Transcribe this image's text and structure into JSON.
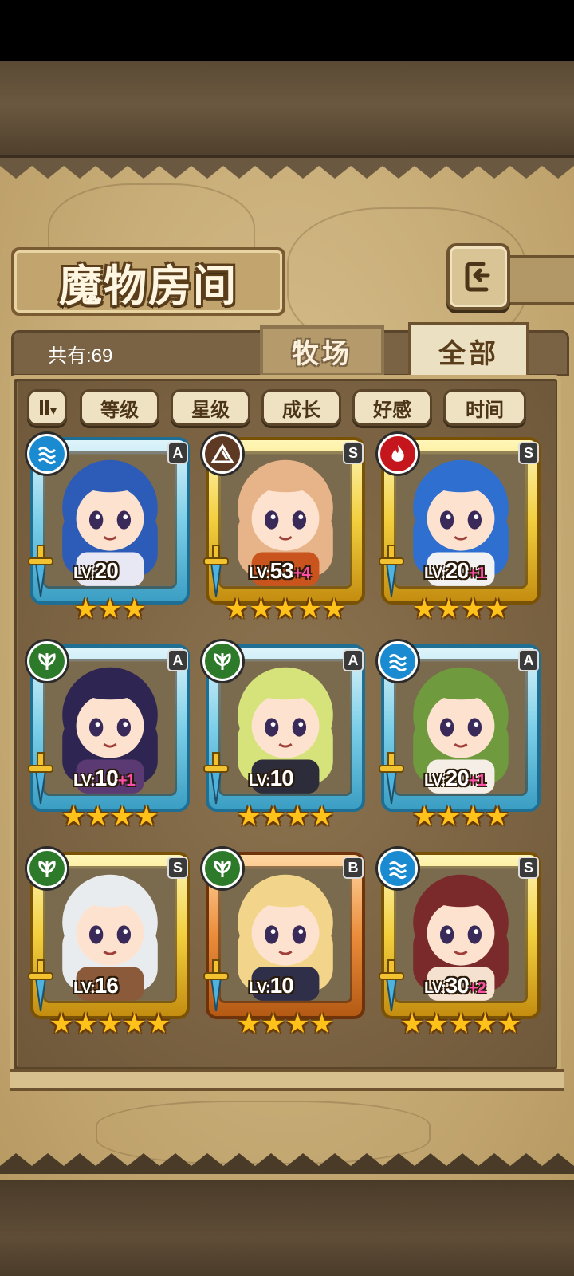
{
  "header": {
    "title": "魔物房间",
    "back_icon": "back-arrow-icon"
  },
  "summary": {
    "count_label": "共有:69"
  },
  "tabs": [
    {
      "label": "牧场",
      "active": false
    },
    {
      "label": "全部",
      "active": true
    }
  ],
  "sort": {
    "order_icon": "sort-order-icon",
    "buttons": [
      "等级",
      "星级",
      "成长",
      "好感",
      "时间"
    ]
  },
  "cards": [
    {
      "element": "water",
      "rank": "A",
      "level": "20",
      "bonus": "",
      "stars": 3,
      "lv_prefix": "LV:",
      "hair": "#2d5bb8",
      "outfit": "#e8e8f5"
    },
    {
      "element": "earth",
      "rank": "S",
      "level": "53",
      "bonus": "+4",
      "stars": 5,
      "lv_prefix": "LV:",
      "hair": "#e7b48a",
      "outfit": "#c9541e"
    },
    {
      "element": "fire",
      "rank": "S",
      "level": "20",
      "bonus": "+1",
      "stars": 4,
      "lv_prefix": "LV:",
      "hair": "#2f6fd0",
      "outfit": "#f2f2f2"
    },
    {
      "element": "wood",
      "rank": "A",
      "level": "10",
      "bonus": "+1",
      "stars": 4,
      "lv_prefix": "LV:",
      "hair": "#2e2552",
      "outfit": "#5b3a73"
    },
    {
      "element": "wood",
      "rank": "A",
      "level": "10",
      "bonus": "",
      "stars": 4,
      "lv_prefix": "LV:",
      "hair": "#d6e27a",
      "outfit": "#2c2c3a"
    },
    {
      "element": "water",
      "rank": "A",
      "level": "20",
      "bonus": "+1",
      "stars": 4,
      "lv_prefix": "LV:",
      "hair": "#6f9a3e",
      "outfit": "#f4eee6"
    },
    {
      "element": "wood",
      "rank": "S",
      "level": "16",
      "bonus": "",
      "stars": 5,
      "lv_prefix": "LV:",
      "hair": "#e9ecef",
      "outfit": "#8a5a3a"
    },
    {
      "element": "wood",
      "rank": "B",
      "level": "10",
      "bonus": "",
      "stars": 4,
      "lv_prefix": "LV:",
      "hair": "#f2d58a",
      "outfit": "#2f2f4a"
    },
    {
      "element": "water",
      "rank": "S",
      "level": "30",
      "bonus": "+2",
      "stars": 5,
      "lv_prefix": "LV:",
      "hair": "#7a2a2a",
      "outfit": "#f5e1d0"
    }
  ],
  "colors": {
    "parchment": "#c8ad78",
    "panel": "#8a7049",
    "star": "#ffc21a",
    "bonus": "#ff4fa8"
  }
}
